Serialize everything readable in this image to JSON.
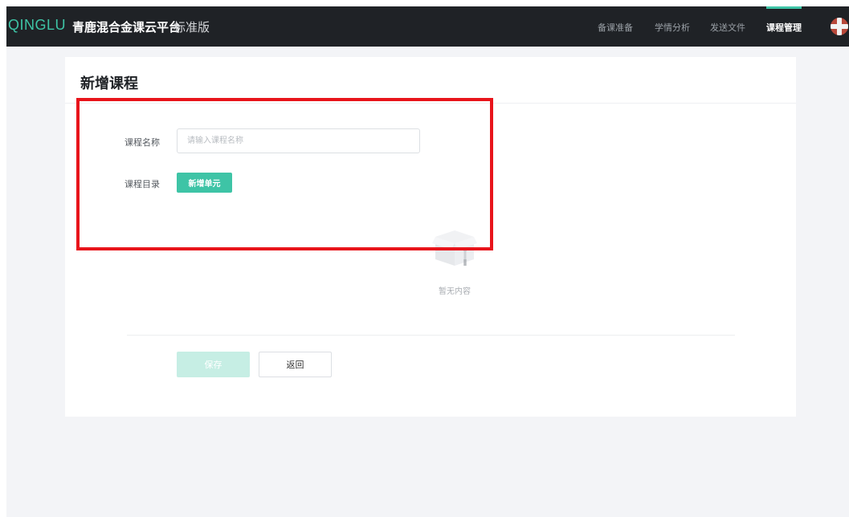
{
  "header": {
    "logo_text": "QINGLU",
    "platform_name": "青鹿混合金课云平台",
    "edition": "标准版",
    "nav": [
      {
        "label": "备课准备"
      },
      {
        "label": "学情分析"
      },
      {
        "label": "发送文件"
      },
      {
        "label": "课程管理",
        "active": true
      }
    ],
    "accent_color": "#3ec4a6"
  },
  "page": {
    "title": "新增课程"
  },
  "form": {
    "course_name_label": "课程名称",
    "course_name_placeholder": "请输入课程名称",
    "course_name_value": "",
    "catalog_label": "课程目录",
    "add_unit_button": "新增单元"
  },
  "empty_state": {
    "icon": "empty-box-icon",
    "text": "暂无内容"
  },
  "actions": {
    "save_label": "保存",
    "back_label": "返回"
  },
  "annotation": {
    "highlight_color": "#e8141b"
  }
}
